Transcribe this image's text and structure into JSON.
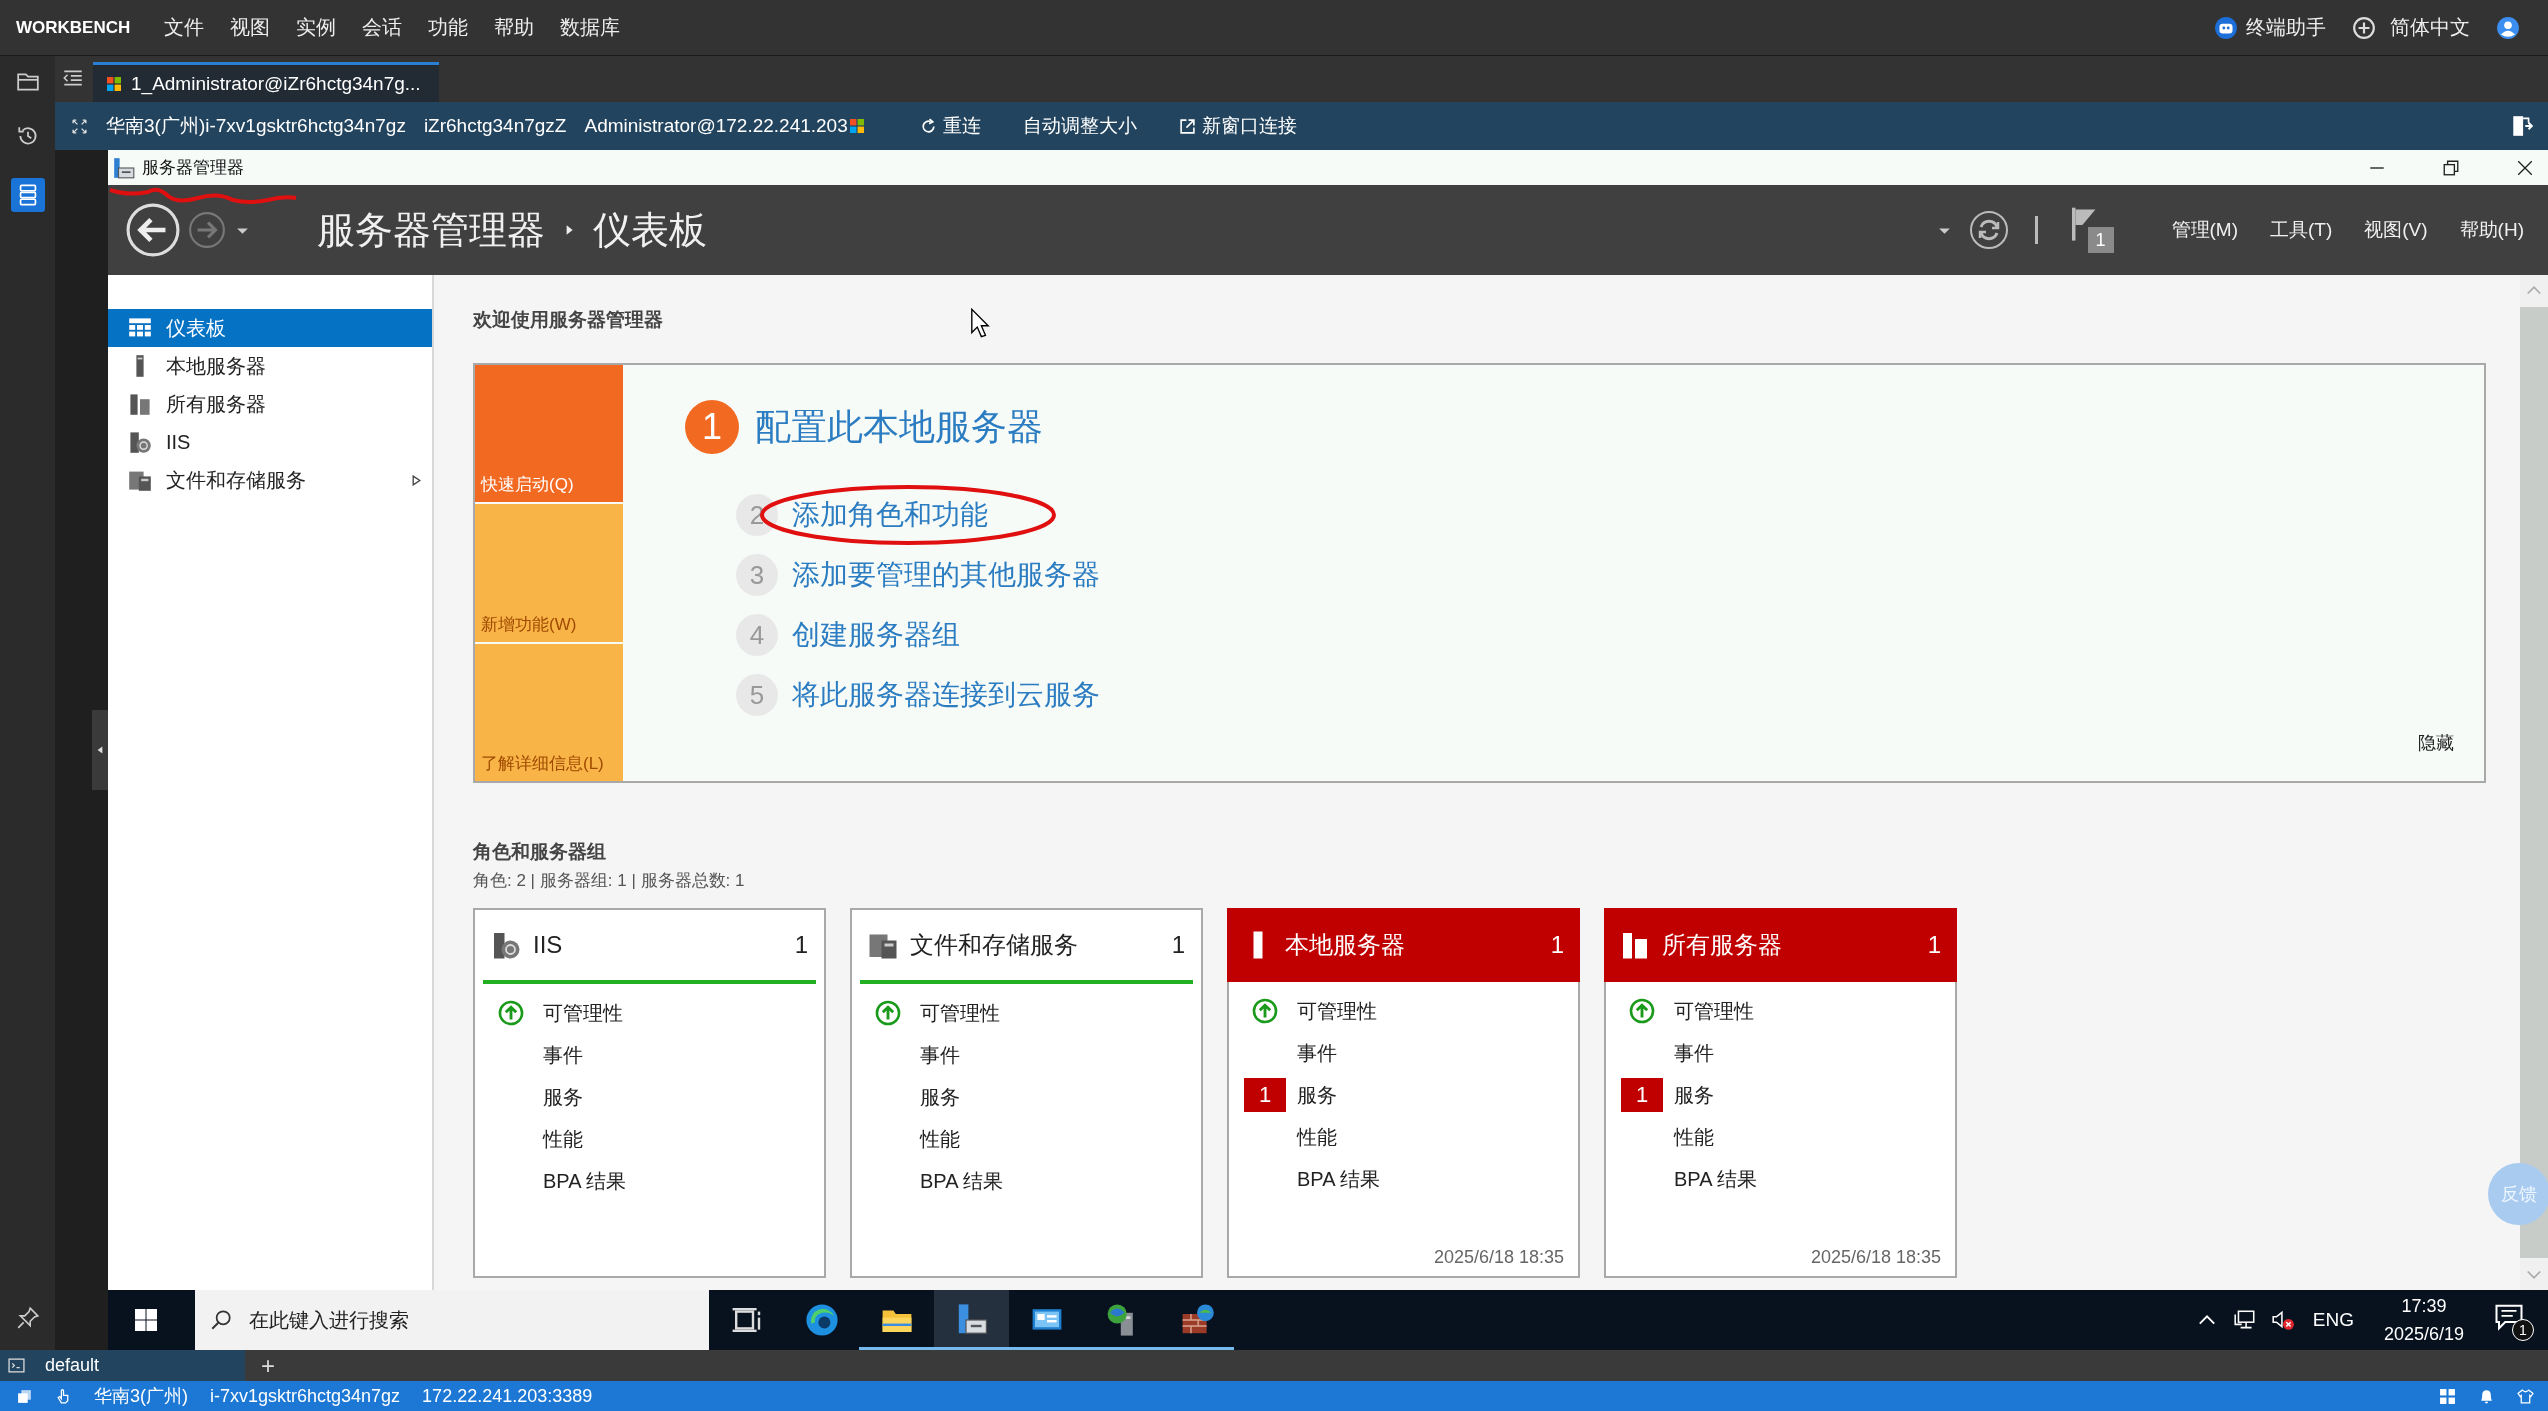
{
  "app_bar": {
    "brand": "WORKBENCH",
    "menus": [
      "文件",
      "视图",
      "实例",
      "会话",
      "功能",
      "帮助",
      "数据库"
    ],
    "assistant": "终端助手",
    "language": "简体中文"
  },
  "tabs": [
    {
      "label": "1_Administrator@iZr6hctg34n7g...",
      "selected": true
    }
  ],
  "remote_toolbar": {
    "instance": "华南3(广州)i-7xv1gsktr6hctg34n7gz",
    "hostname": "iZr6hctg34n7gzZ",
    "account": "Administrator@172.22.241.203",
    "reconnect": "重连",
    "auto_resize": "自动调整大小",
    "new_window": "新窗口连接"
  },
  "server_manager": {
    "window_title": "服务器管理器",
    "breadcrumb": [
      "服务器管理器",
      "仪表板"
    ],
    "notification_count": "1",
    "menus": [
      "管理(M)",
      "工具(T)",
      "视图(V)",
      "帮助(H)"
    ],
    "nav": [
      {
        "label": "仪表板",
        "kind": "dashboard",
        "selected": true,
        "expandable": false
      },
      {
        "label": "本地服务器",
        "kind": "server",
        "selected": false,
        "expandable": false
      },
      {
        "label": "所有服务器",
        "kind": "servers",
        "selected": false,
        "expandable": false
      },
      {
        "label": "IIS",
        "kind": "iis",
        "selected": false,
        "expandable": false
      },
      {
        "label": "文件和存储服务",
        "kind": "files",
        "selected": false,
        "expandable": true
      }
    ],
    "welcome": "欢迎使用服务器管理器",
    "quick_tiles": [
      {
        "label": "快速启动(Q)",
        "selected": true
      },
      {
        "label": "新增功能(W)",
        "selected": false
      },
      {
        "label": "了解详细信息(L)",
        "selected": false
      }
    ],
    "steps": [
      {
        "number": "1",
        "label": "配置此本地服务器",
        "current": true
      },
      {
        "number": "2",
        "label": "添加角色和功能",
        "current": false
      },
      {
        "number": "3",
        "label": "添加要管理的其他服务器",
        "current": false
      },
      {
        "number": "4",
        "label": "创建服务器组",
        "current": false
      },
      {
        "number": "5",
        "label": "将此服务器连接到云服务",
        "current": false
      }
    ],
    "hide": "隐藏",
    "roles_title": "角色和服务器组",
    "roles_summary": "角色: 2 | 服务器组: 1 | 服务器总数: 1",
    "cards": [
      {
        "title": "IIS",
        "count": "1",
        "kind": "iis",
        "alert": false,
        "rows": [
          {
            "label": "可管理性",
            "kind": "status"
          },
          {
            "label": "事件",
            "kind": "plain"
          },
          {
            "label": "服务",
            "kind": "plain"
          },
          {
            "label": "性能",
            "kind": "plain"
          },
          {
            "label": "BPA 结果",
            "kind": "plain"
          }
        ]
      },
      {
        "title": "文件和存储服务",
        "count": "1",
        "kind": "files",
        "alert": false,
        "rows": [
          {
            "label": "可管理性",
            "kind": "status"
          },
          {
            "label": "事件",
            "kind": "plain"
          },
          {
            "label": "服务",
            "kind": "plain"
          },
          {
            "label": "性能",
            "kind": "plain"
          },
          {
            "label": "BPA 结果",
            "kind": "plain"
          }
        ]
      },
      {
        "title": "本地服务器",
        "count": "1",
        "kind": "server",
        "alert": true,
        "timestamp": "2025/6/18 18:35",
        "rows": [
          {
            "label": "可管理性",
            "kind": "status"
          },
          {
            "label": "事件",
            "kind": "plain"
          },
          {
            "label": "服务",
            "kind": "plain",
            "badge": "1"
          },
          {
            "label": "性能",
            "kind": "plain"
          },
          {
            "label": "BPA 结果",
            "kind": "plain"
          }
        ]
      },
      {
        "title": "所有服务器",
        "count": "1",
        "kind": "servers",
        "alert": true,
        "timestamp": "2025/6/18 18:35",
        "rows": [
          {
            "label": "可管理性",
            "kind": "status"
          },
          {
            "label": "事件",
            "kind": "plain"
          },
          {
            "label": "服务",
            "kind": "plain",
            "badge": "1"
          },
          {
            "label": "性能",
            "kind": "plain"
          },
          {
            "label": "BPA 结果",
            "kind": "plain"
          }
        ]
      }
    ],
    "feedback": "反馈"
  },
  "taskbar": {
    "search_placeholder": "在此键入进行搜索",
    "apps": [
      {
        "kind": "task-view",
        "running": false,
        "selected": false
      },
      {
        "kind": "browser",
        "running": false,
        "selected": false
      },
      {
        "kind": "folder",
        "running": true,
        "selected": false
      },
      {
        "kind": "server-manager",
        "running": true,
        "selected": true
      },
      {
        "kind": "monitor",
        "running": true,
        "selected": false
      },
      {
        "kind": "network",
        "running": true,
        "selected": false
      },
      {
        "kind": "firewall",
        "running": true,
        "selected": false
      }
    ],
    "language": "ENG",
    "time": "17:39",
    "date": "2025/6/19",
    "notification_count": "1"
  },
  "session_bar": {
    "session": "default",
    "add": "+"
  },
  "status_bar": {
    "region": "华南3(广州)",
    "instance": "i-7xv1gsktr6hctg34n7gz",
    "address": "172.22.241.203:3389"
  }
}
